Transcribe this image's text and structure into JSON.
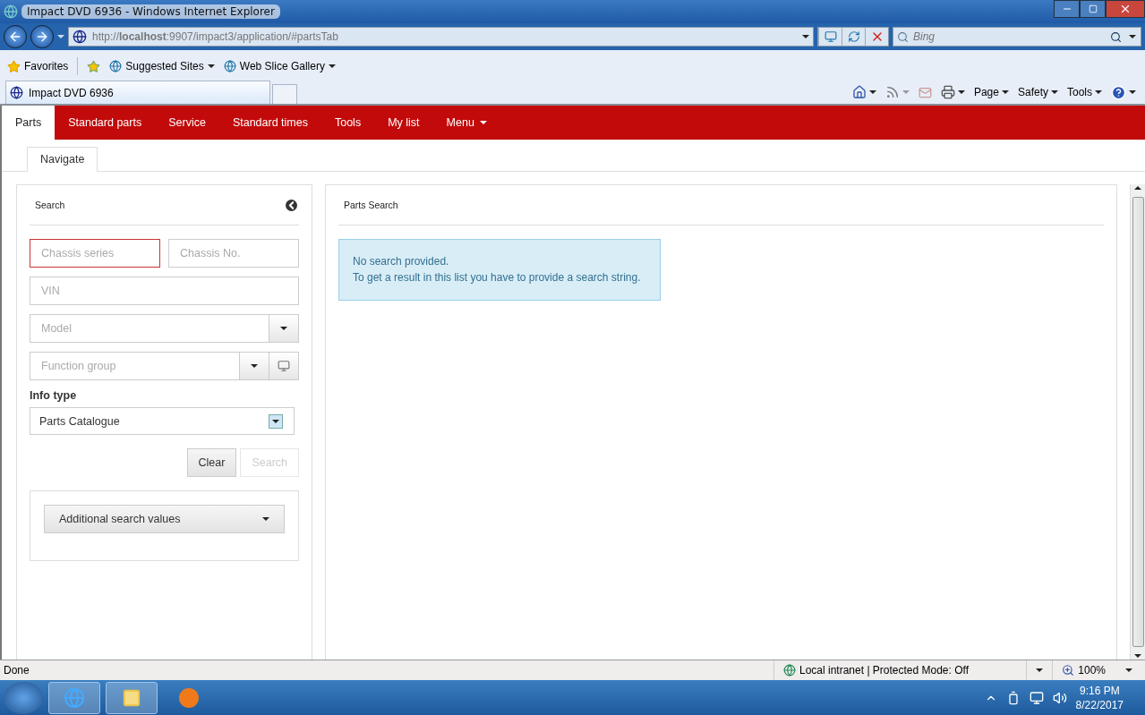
{
  "window": {
    "title": "Impact DVD 6936 - Windows Internet Explorer"
  },
  "address_bar": {
    "url": "http://**localhost**:9907/impact3/application/#partsTab"
  },
  "search_box": {
    "placeholder": "Bing"
  },
  "favorites_bar": {
    "label": "Favorites",
    "links": [
      "Suggested Sites",
      "Web Slice Gallery"
    ]
  },
  "browser_tabs": [
    {
      "label": "Impact DVD 6936",
      "selected": true
    }
  ],
  "command_bar": [
    "Page",
    "Safety",
    "Tools"
  ],
  "app_nav": [
    {
      "label": "Parts",
      "selected": true,
      "kind": "link"
    },
    {
      "label": "Standard parts",
      "selected": false,
      "kind": "link"
    },
    {
      "label": "Service",
      "selected": false,
      "kind": "link"
    },
    {
      "label": "Standard times",
      "selected": false,
      "kind": "link"
    },
    {
      "label": "Tools",
      "selected": false,
      "kind": "link"
    },
    {
      "label": "My list",
      "selected": false,
      "kind": "link"
    },
    {
      "label": "Menu",
      "selected": false,
      "kind": "dropdown"
    }
  ],
  "sub_tabs": [
    {
      "label": "Navigate",
      "selected": true
    }
  ],
  "search_panel": {
    "title": "Search",
    "field_rows": [
      [
        {
          "placeholder": "Chassis series",
          "kind": "text",
          "invalid": true
        },
        {
          "placeholder": "Chassis No.",
          "kind": "text",
          "invalid": false
        }
      ],
      [
        {
          "placeholder": "VIN",
          "kind": "text",
          "invalid": false
        }
      ],
      [
        {
          "placeholder": "Model",
          "kind": "select",
          "invalid": false
        }
      ],
      [
        {
          "placeholder": "Function group",
          "kind": "select_picker",
          "invalid": false
        }
      ]
    ],
    "info_type": {
      "label": "Info type",
      "value": "Parts Catalogue"
    },
    "buttons": [
      {
        "label": "Clear",
        "disabled": false
      },
      {
        "label": "Search",
        "disabled": true
      }
    ],
    "additional": "Additional search values"
  },
  "results_panel": {
    "title": "Parts Search",
    "message": [
      "No search provided.",
      "To get a result in this list you have to provide a search string."
    ]
  },
  "status_bar": {
    "text": "Done",
    "zone": "Local intranet | Protected Mode: Off",
    "zoom": "100%"
  },
  "taskbar": {
    "time": "9:16 PM",
    "date": "8/22/2017"
  }
}
